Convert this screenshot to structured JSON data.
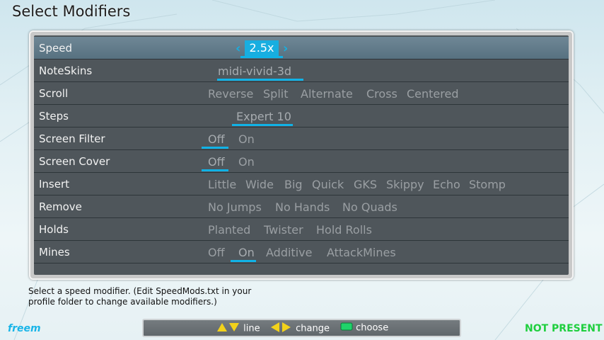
{
  "screen": {
    "title": "Select Modifiers"
  },
  "rows": [
    {
      "label": "Speed",
      "active": true,
      "speed_value": "2.5x"
    },
    {
      "label": "NoteSkins",
      "choices": [
        "midi-vivid-3d"
      ],
      "selected": 0
    },
    {
      "label": "Scroll",
      "choices": [
        "Reverse",
        "Split",
        "Alternate",
        "Cross",
        "Centered"
      ]
    },
    {
      "label": "Steps",
      "choices": [
        "Expert 10"
      ],
      "selected": 0
    },
    {
      "label": "Screen Filter",
      "choices": [
        "Off",
        "On"
      ],
      "selected": 0
    },
    {
      "label": "Screen Cover",
      "choices": [
        "Off",
        "On"
      ],
      "selected": 0
    },
    {
      "label": "Insert",
      "choices": [
        "Little",
        "Wide",
        "Big",
        "Quick",
        "GKS",
        "Skippy",
        "Echo",
        "Stomp"
      ]
    },
    {
      "label": "Remove",
      "choices": [
        "No Jumps",
        "No Hands",
        "No Quads"
      ]
    },
    {
      "label": "Holds",
      "choices": [
        "Planted",
        "Twister",
        "Hold Rolls"
      ]
    },
    {
      "label": "Mines",
      "choices": [
        "Off",
        "On",
        "Additive",
        "AttackMines"
      ],
      "selected": 1
    }
  ],
  "explanation": "Select a speed modifier. (Edit SpeedMods.txt in your profile folder to change available modifiers.)",
  "footer": {
    "logo": "freem",
    "status": "NOT PRESENT",
    "help": {
      "line": "line",
      "change": "change",
      "choose": "choose"
    }
  },
  "colors": {
    "accent": "#18aee0",
    "status": "#1fcf3e",
    "choose_icon": "#1fd36a",
    "arrow_icons": "#f2d21a"
  }
}
